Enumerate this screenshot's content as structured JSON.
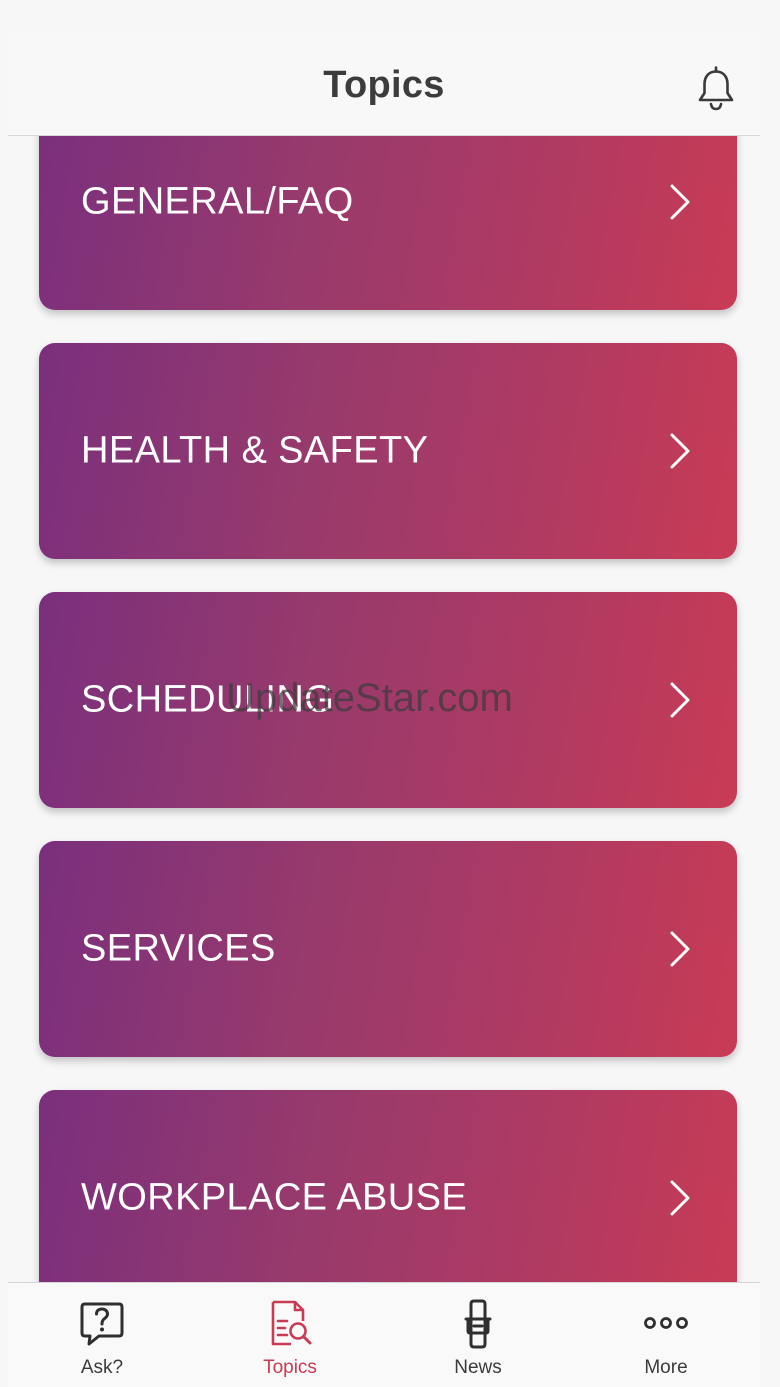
{
  "header": {
    "title": "Topics",
    "bell_icon": "bell-icon"
  },
  "topics": [
    {
      "label": "GENERAL/FAQ"
    },
    {
      "label": "HEALTH & SAFETY"
    },
    {
      "label": "SCHEDULING"
    },
    {
      "label": "SERVICES"
    },
    {
      "label": "WORKPLACE ABUSE"
    }
  ],
  "watermark": "UpdateStar.com",
  "nav": {
    "items": [
      {
        "label": "Ask?",
        "icon": "question-bubble-icon",
        "active": false
      },
      {
        "label": "Topics",
        "icon": "document-search-icon",
        "active": true
      },
      {
        "label": "News",
        "icon": "news-device-icon",
        "active": false
      },
      {
        "label": "More",
        "icon": "more-dots-icon",
        "active": false
      }
    ]
  },
  "colors": {
    "accent": "#c93b55",
    "gradient_start": "#7a2f7d",
    "gradient_end": "#c93b55",
    "text_dark": "#3c3c3c"
  }
}
